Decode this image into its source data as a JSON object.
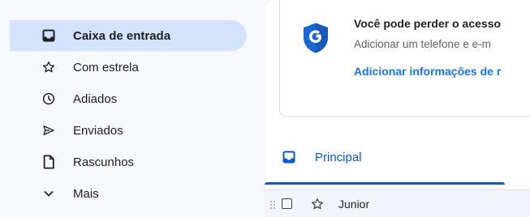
{
  "sidebar": {
    "items": [
      {
        "label": "Caixa de entrada",
        "icon": "inbox-icon",
        "active": true
      },
      {
        "label": "Com estrela",
        "icon": "star-icon",
        "active": false
      },
      {
        "label": "Adiados",
        "icon": "clock-icon",
        "active": false
      },
      {
        "label": "Enviados",
        "icon": "send-icon",
        "active": false
      },
      {
        "label": "Rascunhos",
        "icon": "draft-icon",
        "active": false
      },
      {
        "label": "Mais",
        "icon": "chevron-down-icon",
        "active": false
      }
    ]
  },
  "security_card": {
    "icon": "google-shield-icon",
    "title": "Você pode perder o acesso",
    "subtitle": "Adicionar um telefone e e-m",
    "link": "Adicionar informações de r"
  },
  "tabs": [
    {
      "label": "Principal",
      "icon": "inbox-icon",
      "selected": true
    }
  ],
  "email_list": [
    {
      "sender": "Junior",
      "starred": false
    }
  ],
  "colors": {
    "accent": "#0b57d0",
    "active_nav_bg": "#d3e3fd",
    "link": "#1a73e8",
    "shield_blue": "#1967d2"
  }
}
